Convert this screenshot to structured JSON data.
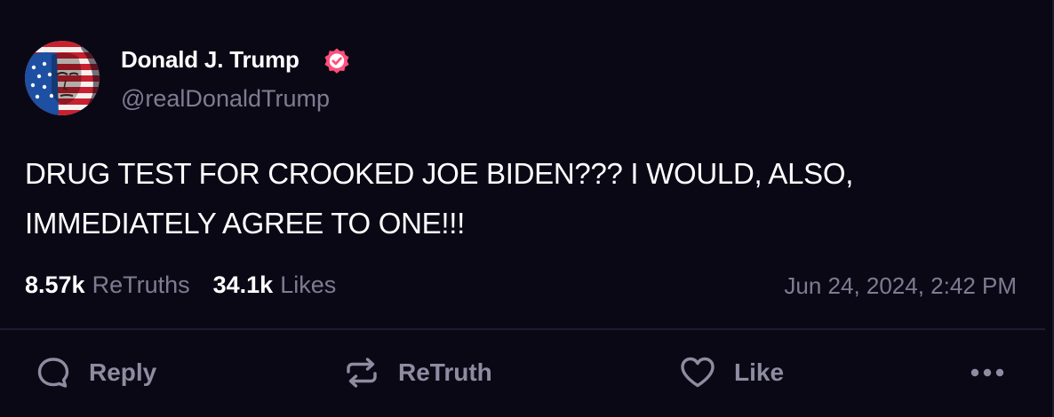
{
  "post": {
    "author": {
      "name": "Donald J. Trump",
      "handle": "@realDonaldTrump",
      "verified_icon": "verified-badge-icon",
      "avatar_icon": "flag-portrait-avatar"
    },
    "text_lines": [
      "DRUG TEST FOR CROOKED JOE BIDEN??? I WOULD, ALSO,",
      "IMMEDIATELY AGREE TO ONE!!!"
    ],
    "stats": {
      "retruths_count": "8.57k",
      "retruths_label": "ReTruths",
      "likes_count": "34.1k",
      "likes_label": "Likes"
    },
    "timestamp": "Jun 24, 2024, 2:42 PM"
  },
  "actions": {
    "reply_label": "Reply",
    "retruth_label": "ReTruth",
    "like_label": "Like",
    "reply_icon": "speech-bubble-icon",
    "retruth_icon": "repost-arrows-icon",
    "like_icon": "heart-icon",
    "more_icon": "more-dots-icon"
  },
  "colors": {
    "background": "#0b0816",
    "text_primary": "#ffffff",
    "text_secondary": "#7e7c90",
    "action_gray": "#8e8ca0",
    "divider": "#1f1c31",
    "verified_badge": "#ff4f7b"
  }
}
